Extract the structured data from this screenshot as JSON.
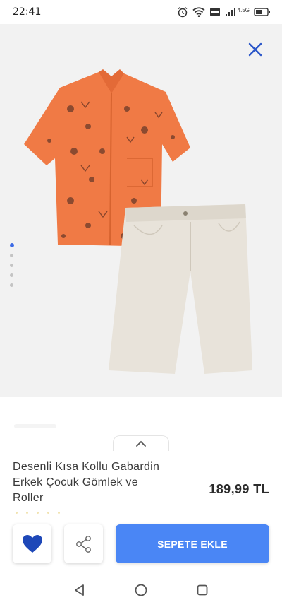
{
  "status_bar": {
    "time": "22:41",
    "network_label": "4.5G"
  },
  "product": {
    "title_line1": "Desenli Kısa Kollu Gabardin",
    "title_line2": "Erkek Çocuk Gömlek ve",
    "title_line3": "Roller",
    "price": "189,99 TL",
    "image_count": 5,
    "active_image_index": 0
  },
  "actions": {
    "add_to_cart_label": "SEPETE EKLE",
    "favorite_icon": "heart-icon",
    "share_icon": "share-icon"
  },
  "colors": {
    "accent": "#4a86f5",
    "heart": "#1e48b8",
    "shirt": "#f07a45",
    "shorts": "#e8e3da"
  }
}
